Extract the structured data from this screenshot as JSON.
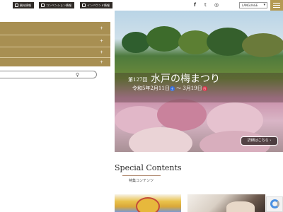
{
  "header": {
    "buttons": [
      {
        "label": "観光情報"
      },
      {
        "label": "コンベンション情報"
      },
      {
        "label": "インバウンド情報"
      }
    ],
    "language": {
      "label": "LANGUAGE"
    },
    "social": {
      "facebook": "f",
      "twitter": "t",
      "instagram": "◎"
    }
  },
  "sidebar": {
    "search_placeholder": ""
  },
  "hero": {
    "edition": "第127回",
    "title": "水戸の梅まつり",
    "date_start": "令和5年2月11日",
    "day_start": "土",
    "tilde": "〜",
    "date_end": "3月19日",
    "day_end": "日",
    "button": "詳細はこちら ›",
    "colors": {
      "sat": "#3a6fd8",
      "sun": "#d8334a"
    }
  },
  "special": {
    "title": "Special Contents",
    "subtitle": "特集コンテンツ"
  }
}
